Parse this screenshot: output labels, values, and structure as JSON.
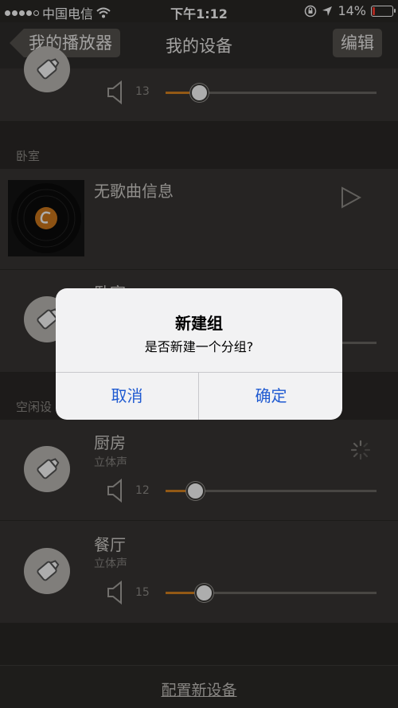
{
  "status_bar": {
    "carrier": "中国电信",
    "time": "下午1:12",
    "battery_percent": "14%",
    "battery_level": 0.14
  },
  "nav": {
    "back_label": "我的播放器",
    "title": "我的设备",
    "edit_label": "编辑"
  },
  "top_device": {
    "volume": "13",
    "volume_level": 0.16
  },
  "sections": {
    "bedroom": "卧室",
    "idle": "空闲设"
  },
  "now_playing": {
    "title": "无歌曲信息"
  },
  "bedroom_device": {
    "name": "卧室"
  },
  "devices": [
    {
      "name": "厨房",
      "sub": "立体声",
      "volume": "12",
      "volume_level": 0.14
    },
    {
      "name": "餐厅",
      "sub": "立体声",
      "volume": "15",
      "volume_level": 0.18
    }
  ],
  "alert": {
    "title": "新建组",
    "message": "是否新建一个分组?",
    "cancel_label": "取消",
    "confirm_label": "确定"
  },
  "footer": {
    "config_label": "配置新设备"
  },
  "colors": {
    "accent_orange": "#d9831f",
    "alert_button_blue": "#1f5ad1",
    "battery_red": "#ff3b30"
  }
}
